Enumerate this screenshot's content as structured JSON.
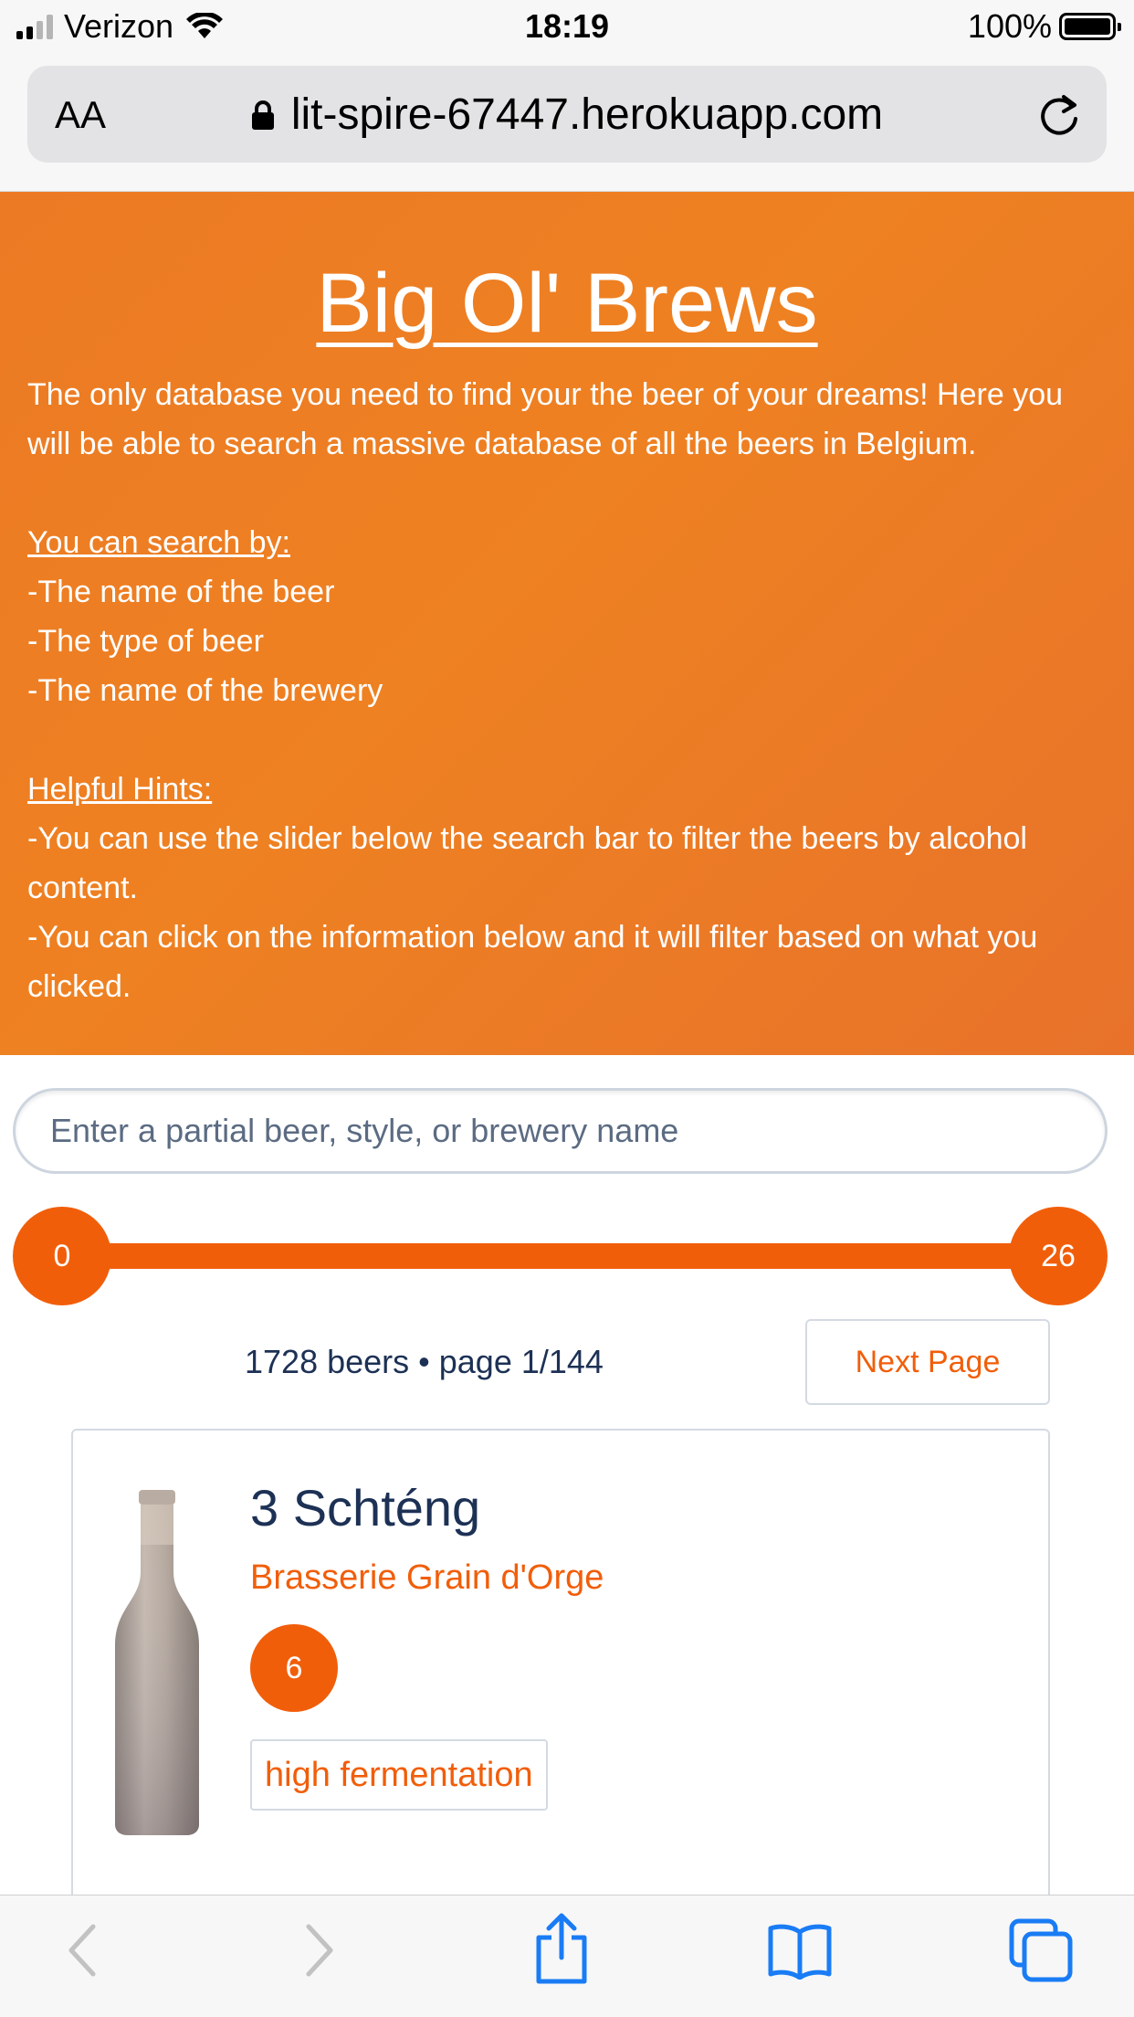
{
  "status_bar": {
    "carrier": "Verizon",
    "time": "18:19",
    "battery": "100%"
  },
  "browser": {
    "text_size_label": "AA",
    "url": "lit-spire-67447.herokuapp.com"
  },
  "header": {
    "title": "Big Ol' Brews",
    "intro": "The only database you need to find your the beer of your dreams! Here you will be able to search a massive database of all the beers in Belgium.",
    "search_by_heading": "You can search by:",
    "search_by_items": [
      "-The name of the beer",
      "-The type of beer",
      "-The name of the brewery"
    ],
    "hints_heading": "Helpful Hints:",
    "hints": [
      "-You can use the slider below the search bar to filter the beers by alcohol content.",
      "-You can click on the information below and it will filter based on what you clicked."
    ]
  },
  "search": {
    "placeholder": "Enter a partial beer, style, or brewery name",
    "value": ""
  },
  "slider": {
    "min_label": "0",
    "max_label": "26"
  },
  "results": {
    "summary": "1728 beers • page 1/144",
    "next_page_label": "Next Page"
  },
  "beers": [
    {
      "name": "3 Schténg",
      "brewery": "Brasserie Grain d'Orge",
      "abv": "6",
      "style": "high fermentation"
    }
  ],
  "colors": {
    "accent": "#f15e0a",
    "header_bg": "#ec7a24",
    "navy_text": "#1d3155",
    "ios_blue": "#1a7cf5"
  }
}
